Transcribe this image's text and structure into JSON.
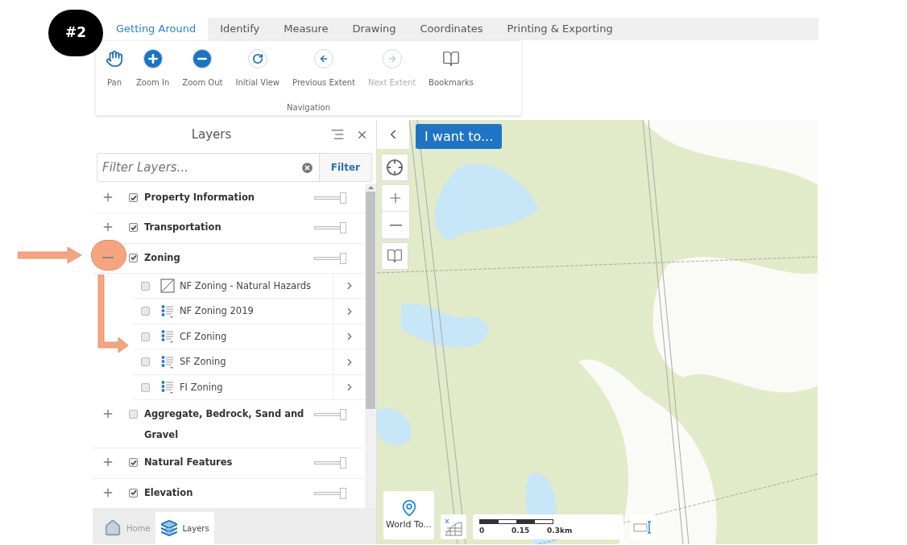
{
  "badge": "#2",
  "tabs": [
    {
      "label": "Getting Around",
      "selected": true
    },
    {
      "label": "Identify",
      "selected": false
    },
    {
      "label": "Measure",
      "selected": false
    },
    {
      "label": "Drawing",
      "selected": false
    },
    {
      "label": "Coordinates",
      "selected": false
    },
    {
      "label": "Printing & Exporting",
      "selected": false
    }
  ],
  "toolbar": {
    "group_label": "Navigation",
    "buttons": [
      {
        "label": "Pan",
        "kind": "hand",
        "disabled": false
      },
      {
        "label": "Zoom In",
        "kind": "plus",
        "disabled": false
      },
      {
        "label": "Zoom Out",
        "kind": "minus",
        "disabled": false
      },
      {
        "label": "Initial View",
        "kind": "rotate",
        "disabled": false
      },
      {
        "label": "Previous Extent",
        "kind": "back",
        "disabled": false
      },
      {
        "label": "Next Extent",
        "kind": "forward",
        "disabled": true
      },
      {
        "label": "Bookmarks",
        "kind": "book",
        "disabled": false
      }
    ]
  },
  "layers_panel": {
    "title": "Layers",
    "filter": {
      "placeholder": "Filter Layers...",
      "button": "Filter"
    },
    "layers": [
      {
        "name": "Property Information",
        "checked": true,
        "expanded": false,
        "level": 1
      },
      {
        "name": "Transportation",
        "checked": true,
        "expanded": false,
        "level": 1
      },
      {
        "name": "Zoning",
        "checked": true,
        "expanded": true,
        "level": 1,
        "children": [
          {
            "name": "NF Zoning - Natural Hazards",
            "checked": false,
            "kind": "hatch"
          },
          {
            "name": "NF Zoning 2019",
            "checked": false,
            "kind": "legend"
          },
          {
            "name": "CF Zoning",
            "checked": false,
            "kind": "legend"
          },
          {
            "name": "SF Zoning",
            "checked": false,
            "kind": "legend"
          },
          {
            "name": "FI Zoning",
            "checked": false,
            "kind": "legend"
          }
        ]
      },
      {
        "name": "Aggregate, Bedrock, Sand and Gravel",
        "checked": false,
        "expanded": false,
        "level": 1
      },
      {
        "name": "Natural Features",
        "checked": true,
        "expanded": false,
        "level": 1
      },
      {
        "name": "Elevation",
        "checked": true,
        "expanded": false,
        "level": 1
      }
    ]
  },
  "bottom_tabs": [
    {
      "label": "Home",
      "kind": "home",
      "selected": false
    },
    {
      "label": "Layers",
      "kind": "layers",
      "selected": true
    }
  ],
  "map": {
    "action_button": "I want to...",
    "basemap_label": "World To...",
    "scale_labels": [
      "0",
      "0.15",
      "0.3km"
    ]
  }
}
